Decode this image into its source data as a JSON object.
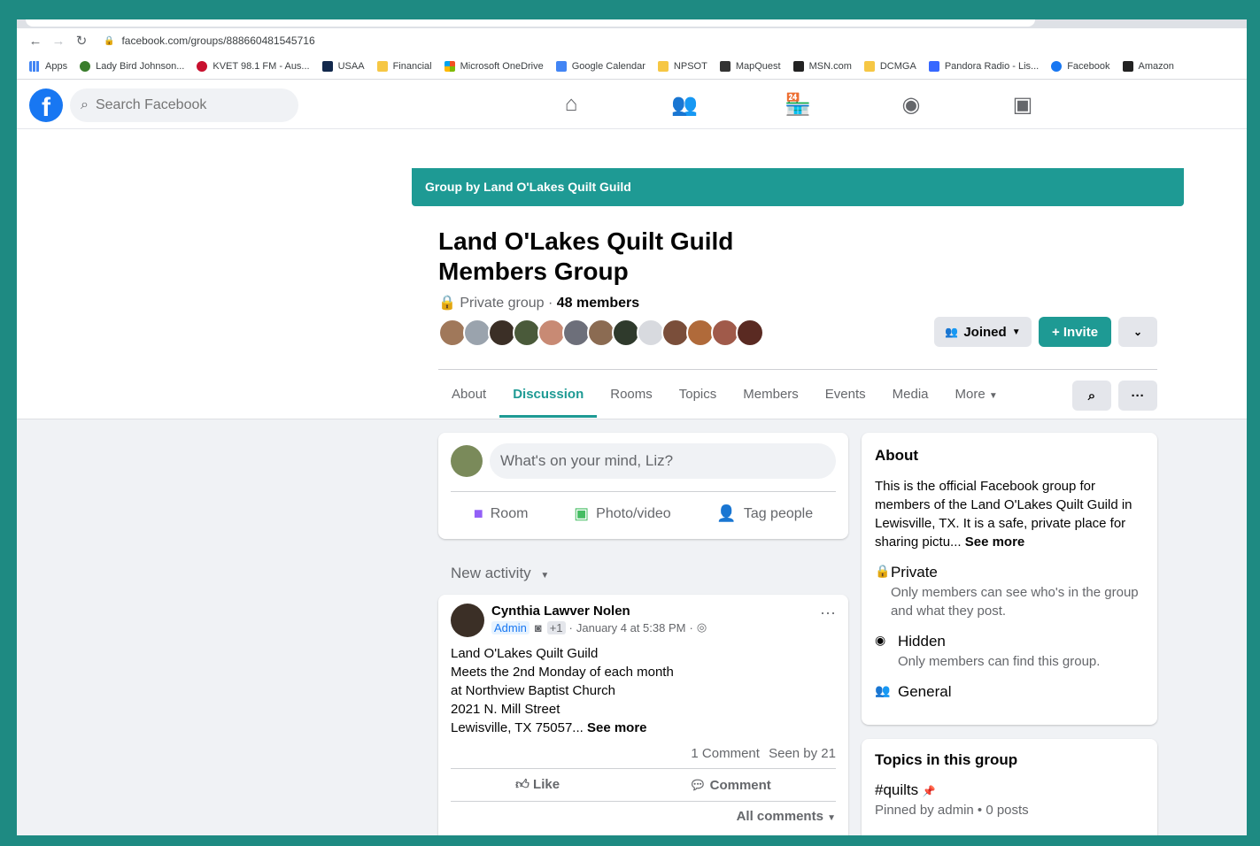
{
  "browser": {
    "url": "facebook.com/groups/888660481545716",
    "bookmarks": [
      "Apps",
      "Lady Bird Johnson...",
      "KVET 98.1 FM - Aus...",
      "USAA",
      "Financial",
      "Microsoft OneDrive",
      "Google Calendar",
      "NPSOT",
      "MapQuest",
      "MSN.com",
      "DCMGA",
      "Pandora Radio - Lis...",
      "Facebook",
      "Amazon"
    ]
  },
  "fb": {
    "logo_letter": "f",
    "search_placeholder": "Search Facebook"
  },
  "group": {
    "banner": "Group by Land O'Lakes Quilt Guild",
    "title": "Land O'Lakes Quilt Guild Members Group",
    "privacy": "Private group",
    "members": "48 members",
    "joined_label": "Joined",
    "invite_label": "+ Invite",
    "tabs": [
      "About",
      "Discussion",
      "Rooms",
      "Topics",
      "Members",
      "Events",
      "Media",
      "More"
    ]
  },
  "composer": {
    "placeholder": "What's on your mind, Liz?",
    "room": "Room",
    "photo": "Photo/video",
    "tag": "Tag people"
  },
  "sort_label": "New activity",
  "post": {
    "author": "Cynthia Lawver Nolen",
    "badge": "Admin",
    "plus": "+1",
    "date": "January 4 at 5:38 PM",
    "lines": [
      "Land O'Lakes Quilt Guild",
      "Meets the 2nd Monday of each month",
      "at Northview Baptist Church",
      "2021 N. Mill Street",
      "Lewisville, TX 75057..."
    ],
    "see_more": "See more",
    "comments": "1 Comment",
    "seen": "Seen by 21",
    "like": "Like",
    "comment": "Comment",
    "all_comments": "All comments"
  },
  "about": {
    "title": "About",
    "text": "This is the official Facebook group for members of the Land O'Lakes Quilt Guild in Lewisville, TX. It is a safe, private place for sharing pictu...",
    "see_more": "See more",
    "private_title": "Private",
    "private_desc": "Only members can see who's in the group and what they post.",
    "hidden_title": "Hidden",
    "hidden_desc": "Only members can find this group.",
    "general": "General"
  },
  "topics": {
    "title": "Topics in this group",
    "tag": "#quilts",
    "pinned": "Pinned by admin • 0 posts"
  },
  "colors": {
    "teal": "#1e9a94",
    "fb_blue": "#1877f2",
    "frame": "#1e8a82"
  }
}
